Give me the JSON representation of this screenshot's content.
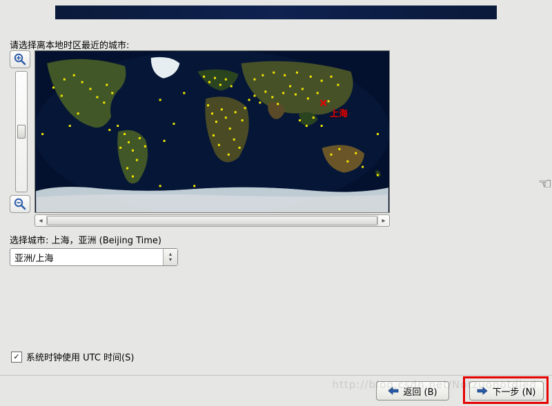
{
  "banner": {},
  "prompt": "请选择离本地时区最近的城市:",
  "map": {
    "selected_city_label": "上海",
    "zoom_in_name": "zoom-in",
    "zoom_out_name": "zoom-out"
  },
  "selected": {
    "label": "选择城市: 上海，亚洲 (Beijing Time)"
  },
  "timezone_combo": {
    "value": "亚洲/上海"
  },
  "utc": {
    "label": "系统时钟使用 UTC 时间(S)",
    "checked": true
  },
  "buttons": {
    "back": "返回 (B)",
    "next": "下一步 (N)"
  },
  "watermark": "http://blog.csdn.net/Notzuonotdied"
}
